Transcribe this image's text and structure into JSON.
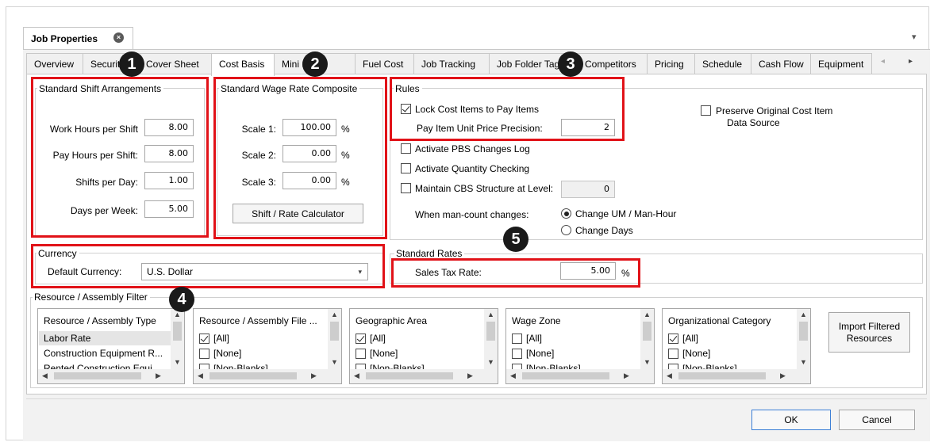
{
  "window": {
    "doc_tab_title": "Job Properties",
    "close_glyph": "×",
    "collapse_glyph": "▾"
  },
  "tabs": [
    {
      "label": "Overview"
    },
    {
      "label": "Security"
    },
    {
      "label": "Cover Sheet"
    },
    {
      "label": "Cost Basis"
    },
    {
      "label": "Mini Setup"
    },
    {
      "label": "Fuel Cost"
    },
    {
      "label": "Job Tracking"
    },
    {
      "label": "Job Folder Tags"
    },
    {
      "label": "Competitors"
    },
    {
      "label": "Pricing"
    },
    {
      "label": "Schedule"
    },
    {
      "label": "Cash Flow"
    },
    {
      "label": "Equipment"
    }
  ],
  "tab_nav": {
    "left": "◂",
    "right": "▸"
  },
  "shift": {
    "title": "Standard Shift Arrangements",
    "rows": [
      {
        "label": "Work Hours per Shift",
        "value": "8.00"
      },
      {
        "label": "Pay Hours per Shift:",
        "value": "8.00"
      },
      {
        "label": "Shifts per Day:",
        "value": "1.00"
      },
      {
        "label": "Days per Week:",
        "value": "5.00"
      }
    ]
  },
  "wage": {
    "title": "Standard Wage Rate Composite",
    "rows": [
      {
        "label": "Scale 1:",
        "value": "100.00",
        "unit": "%"
      },
      {
        "label": "Scale 2:",
        "value": "0.00",
        "unit": "%"
      },
      {
        "label": "Scale 3:",
        "value": "0.00",
        "unit": "%"
      }
    ],
    "calc_button": "Shift / Rate Calculator"
  },
  "rules": {
    "title": "Rules",
    "lock_label": "Lock Cost Items to Pay Items",
    "precision_label": "Pay Item Unit Price Precision:",
    "precision_value": "2",
    "preserve_label_1": "Preserve Original Cost Item",
    "preserve_label_2": "Data Source",
    "pbs_label": "Activate PBS Changes Log",
    "qty_label": "Activate Quantity Checking",
    "cbs_label": "Maintain CBS Structure at Level:",
    "cbs_value": "0",
    "mancount_label": "When man-count changes:",
    "radio_um": "Change UM / Man-Hour",
    "radio_days": "Change Days"
  },
  "currency": {
    "title": "Currency",
    "label": "Default Currency:",
    "value": "U.S. Dollar"
  },
  "rates": {
    "title": "Standard Rates",
    "sales_tax_label": "Sales Tax Rate:",
    "sales_tax_value": "5.00",
    "unit": "%"
  },
  "filter": {
    "title": "Resource / Assembly Filter",
    "lists": [
      {
        "header": "Resource / Assembly Type",
        "items": [
          "Labor Rate",
          "Construction Equipment R...",
          "Rented Construction Equi..."
        ]
      },
      {
        "header": "Resource / Assembly File ...",
        "items": [
          "[All]",
          "[None]",
          "[Non-Blanks]"
        ]
      },
      {
        "header": "Geographic Area",
        "items": [
          "[All]",
          "[None]",
          "[Non-Blanks]"
        ]
      },
      {
        "header": "Wage Zone",
        "items": [
          "[All]",
          "[None]",
          "[Non-Blanks]"
        ]
      },
      {
        "header": "Organizational Category",
        "items": [
          "[All]",
          "[None]",
          "[Non-Blanks]"
        ]
      }
    ],
    "import_button_1": "Import Filtered",
    "import_button_2": "Resources"
  },
  "footer": {
    "ok": "OK",
    "cancel": "Cancel"
  },
  "callouts": [
    "1",
    "2",
    "3",
    "4",
    "5"
  ],
  "colors": {
    "highlight": "#e11218",
    "badge": "#1a1a1a"
  }
}
